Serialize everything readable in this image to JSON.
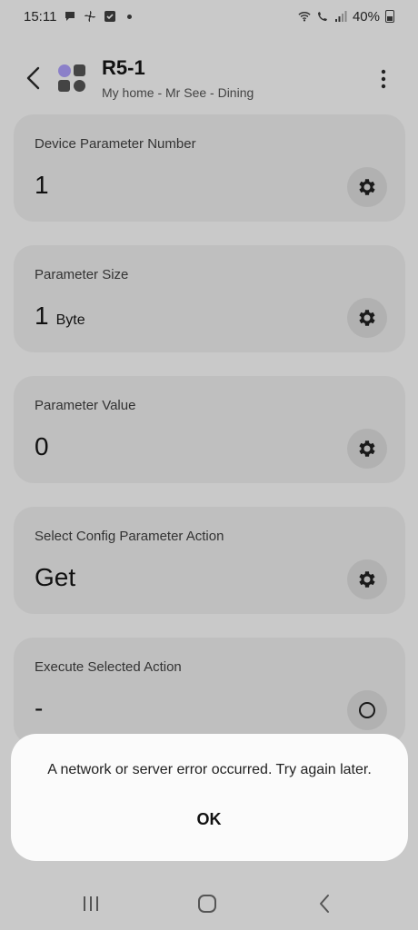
{
  "status_bar": {
    "time": "15:11",
    "battery": "40%"
  },
  "header": {
    "title": "R5-1",
    "subtitle": "My home - Mr See - Dining"
  },
  "cards": [
    {
      "label": "Device Parameter Number",
      "value": "1",
      "unit": "",
      "button_icon": "gear-icon"
    },
    {
      "label": "Parameter Size",
      "value": "1",
      "unit": "Byte",
      "button_icon": "gear-icon"
    },
    {
      "label": "Parameter Value",
      "value": "0",
      "unit": "",
      "button_icon": "gear-icon"
    },
    {
      "label": "Select Config Parameter Action",
      "value": "Get",
      "unit": "",
      "button_icon": "gear-icon"
    },
    {
      "label": "Execute Selected Action",
      "value": "-",
      "unit": "",
      "button_icon": "circle-icon"
    }
  ],
  "dialog": {
    "message": "A network or server error occurred. Try again later.",
    "ok_label": "OK"
  },
  "colors": {
    "background": "#c9c9c9",
    "card": "#bfbfbf",
    "dialog": "#fbfbfb",
    "accent_purple": "#8b80c9"
  }
}
